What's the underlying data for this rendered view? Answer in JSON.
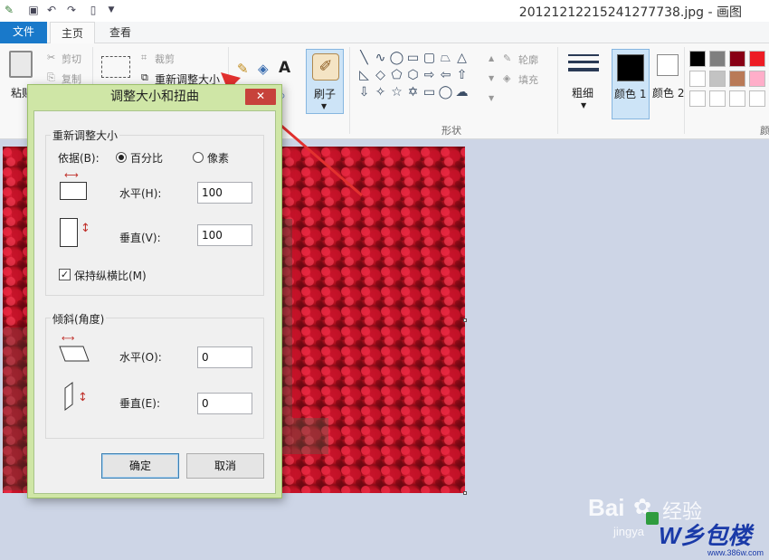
{
  "window": {
    "title": "20121212215241277738.jpg - 画图"
  },
  "quick_access": {
    "icons": [
      "paint-app-icon",
      "save-icon",
      "undo-icon",
      "redo-icon",
      "new-icon",
      "dropdown-icon"
    ]
  },
  "tabs": {
    "file": "文件",
    "home": "主页",
    "view": "查看"
  },
  "ribbon": {
    "clipboard": {
      "paste": "粘贴",
      "cut": "剪切",
      "copy": "复制"
    },
    "image": {
      "crop": "裁剪",
      "resize": "重新调整大小"
    },
    "brush": {
      "label": "刷子"
    },
    "shapes": {
      "label": "形状",
      "outline": "轮廓",
      "fill": "填充"
    },
    "size": {
      "label": "粗细"
    },
    "colors": {
      "color1": "颜色 1",
      "color2": "颜色 2",
      "edit": "颜"
    },
    "palette": [
      "#000000",
      "#7f7f7f",
      "#880015",
      "#ed1c24",
      "#ffffff",
      "#c3c3c3",
      "#b97a57",
      "#ffaec9"
    ]
  },
  "dialog": {
    "title": "调整大小和扭曲",
    "close": "✕",
    "resize": {
      "legend": "重新调整大小",
      "by_label": "依据(B):",
      "option_percent": "百分比",
      "option_pixels": "像素",
      "horizontal_label": "水平(H):",
      "horizontal_value": "100",
      "vertical_label": "垂直(V):",
      "vertical_value": "100",
      "keep_ratio_label": "保持纵横比(M)"
    },
    "skew": {
      "legend": "倾斜(角度)",
      "horizontal_label": "水平(O):",
      "horizontal_value": "0",
      "vertical_label": "垂直(E):",
      "vertical_value": "0"
    },
    "ok": "确定",
    "cancel": "取消"
  },
  "watermark": {
    "baidu": "Bai",
    "jingyan": "经验",
    "sub": "jingya",
    "logo": "W乡包楼",
    "url": "www.386w.com"
  }
}
